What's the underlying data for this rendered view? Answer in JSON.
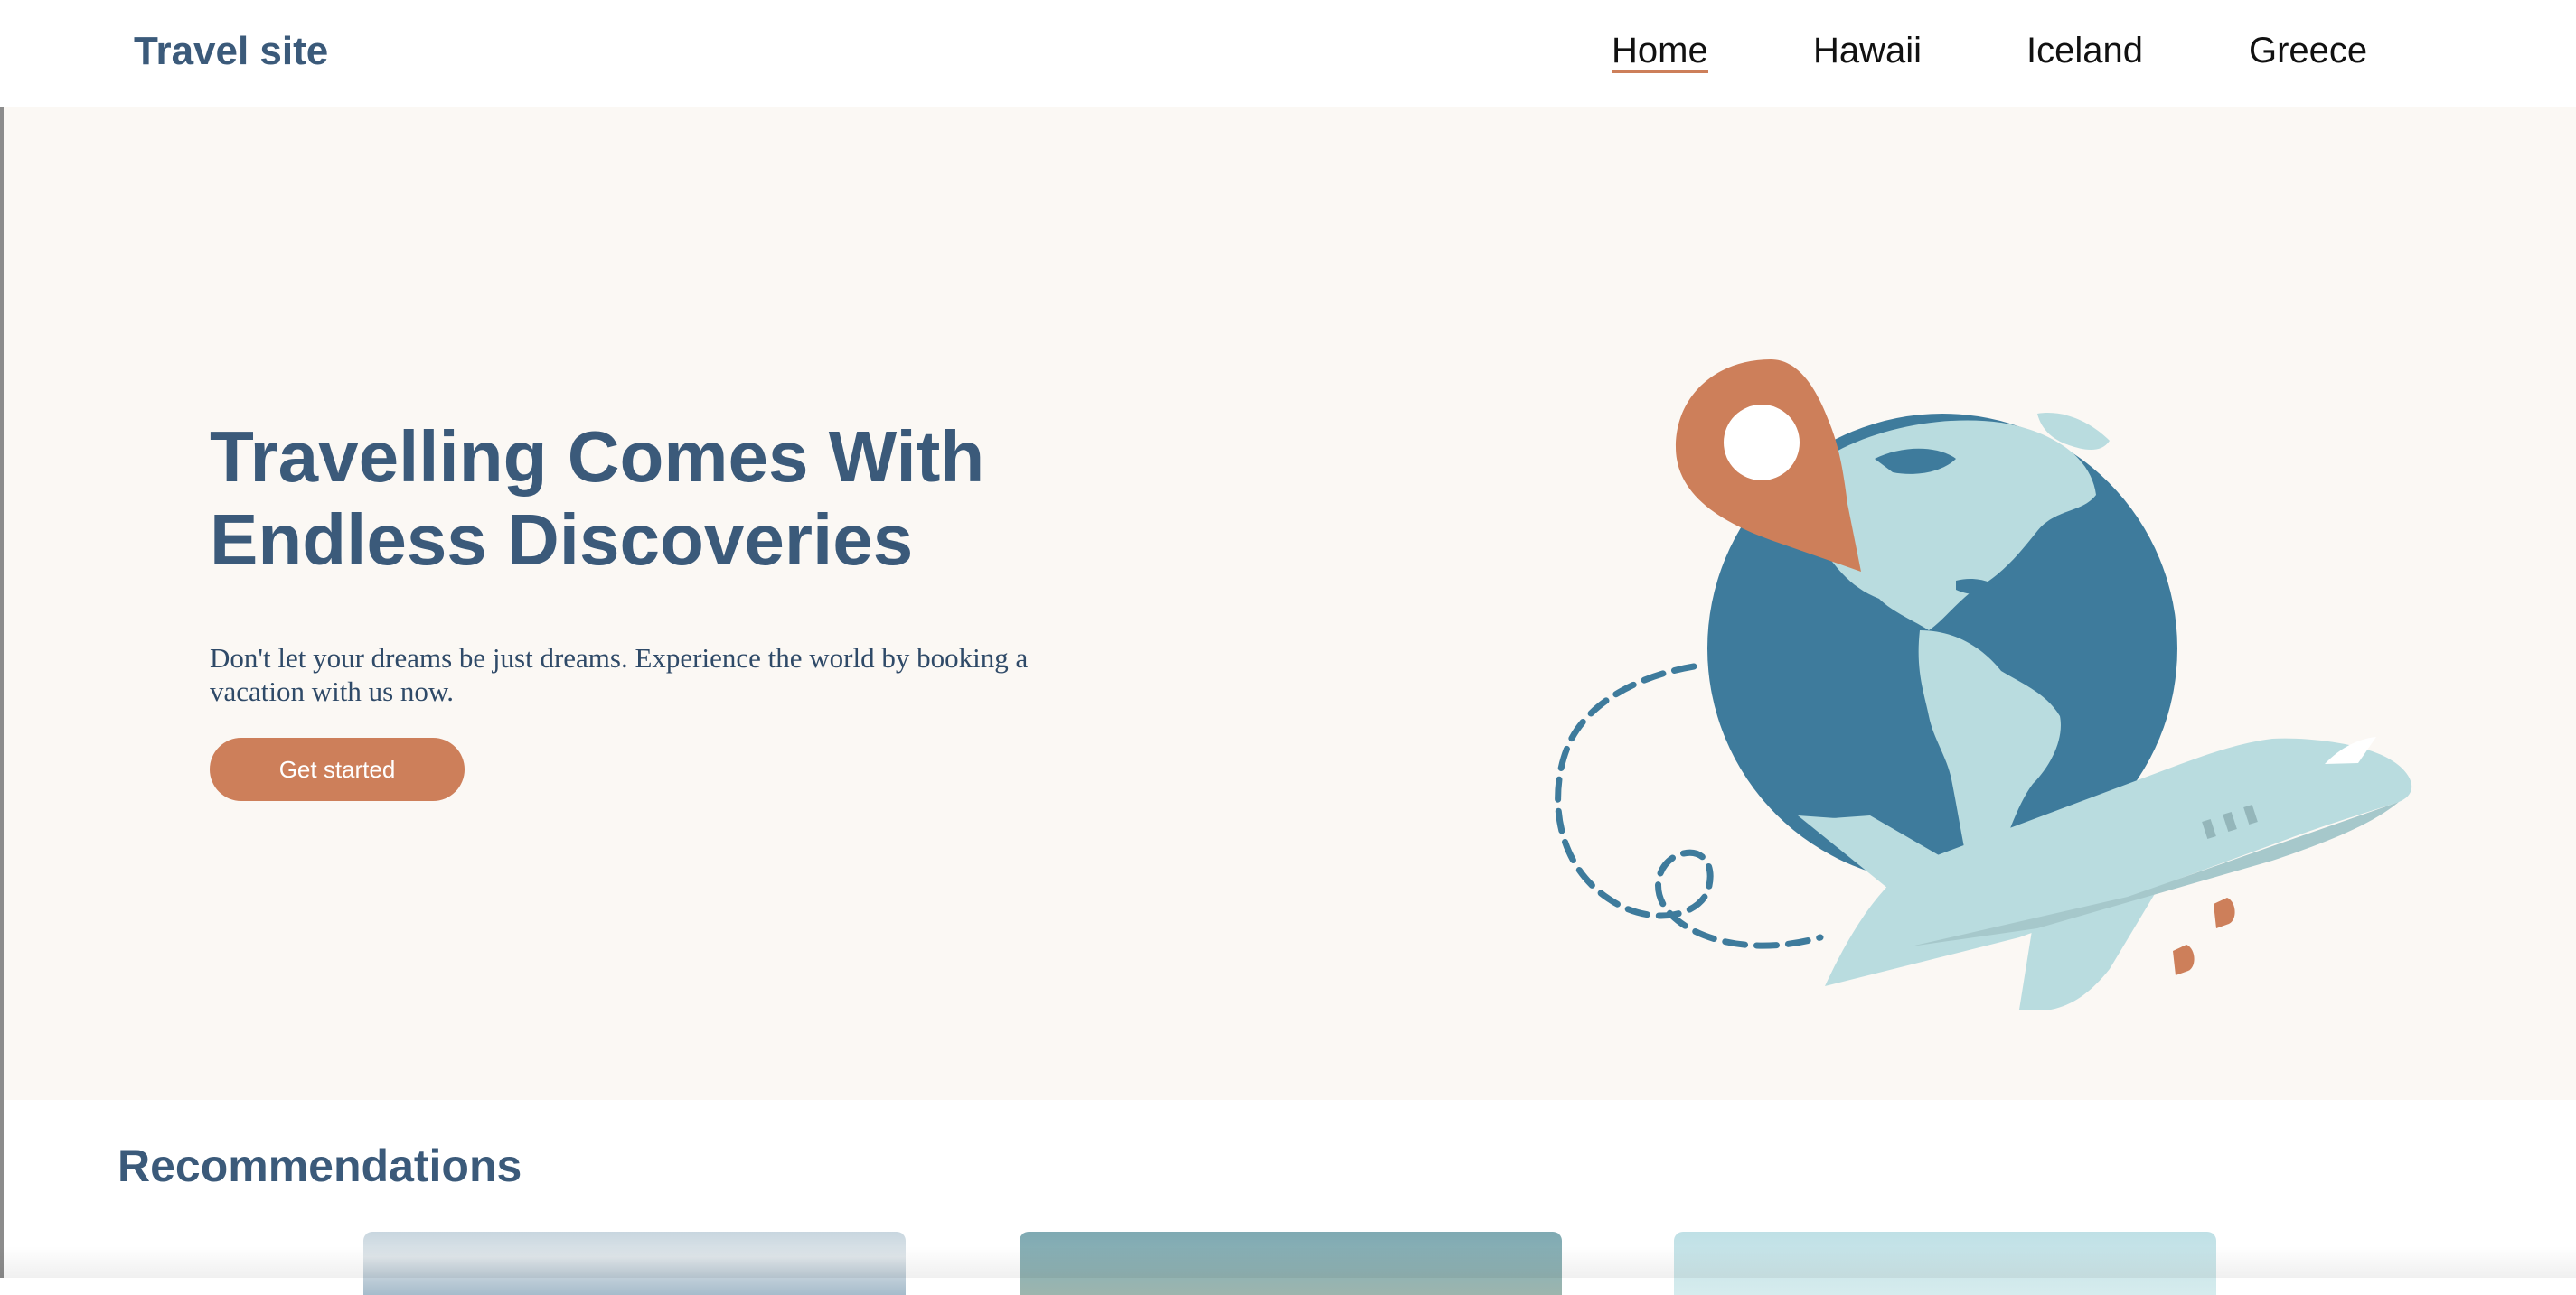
{
  "header": {
    "logo": "Travel site",
    "nav": [
      {
        "label": "Home",
        "active": true
      },
      {
        "label": "Hawaii"
      },
      {
        "label": "Iceland"
      },
      {
        "label": "Greece"
      }
    ]
  },
  "hero": {
    "title": "Travelling Comes With Endless Discoveries",
    "description": "Don't let your dreams be just dreams. Experience the world by booking a vacation with us now.",
    "cta_label": "Get started",
    "illustration": "globe-airplane-location-pin-icon"
  },
  "recommendations": {
    "title": "Recommendations",
    "cards": [
      {
        "image": "palm-trees-sky-photo"
      },
      {
        "image": "teal-landscape-photo"
      },
      {
        "image": "light-blue-sky-photo"
      }
    ]
  },
  "colors": {
    "primary_text": "#3b5a7a",
    "accent": "#cd7f5a",
    "hero_background": "#fbf8f4",
    "globe_ocean": "#3e7b9c",
    "globe_land": "#b9dcdf"
  }
}
